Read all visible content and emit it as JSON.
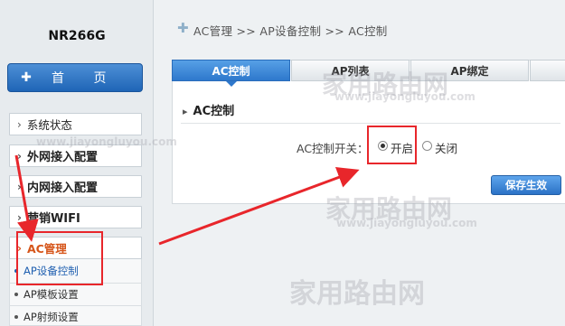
{
  "header": {
    "model": "NR266G"
  },
  "sidebar": {
    "home_label": "首 页",
    "items": [
      {
        "label": "系统状态"
      },
      {
        "label": "外网接入配置"
      },
      {
        "label": "内网接入配置"
      },
      {
        "label": "营销WIFI"
      },
      {
        "label": "AC管理"
      }
    ],
    "subitems": [
      {
        "label": "AP设备控制"
      },
      {
        "label": "AP模板设置"
      },
      {
        "label": "AP射频设置"
      }
    ]
  },
  "breadcrumb": "AC管理 >> AP设备控制 >> AC控制",
  "tabs": [
    "AC控制",
    "AP列表",
    "AP绑定"
  ],
  "section": {
    "title": "AC控制",
    "field_label": "AC控制开关：",
    "radio_on": "开启",
    "radio_off": "关闭",
    "selected": "开启",
    "save_label": "保存生效"
  },
  "watermark": {
    "text": "家用路由网",
    "url": "www.jiayongluyou.com"
  },
  "colors": {
    "accent": "#2e78cc",
    "active_menu": "#d6551a",
    "highlight": "#e8262b"
  }
}
